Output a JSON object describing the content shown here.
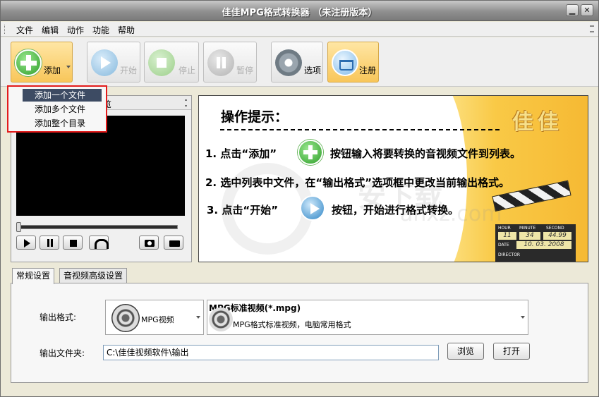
{
  "window": {
    "title": "佳佳MPG格式转换器  （未注册版本）",
    "min_glyph": "▁",
    "close_glyph": "✕"
  },
  "menu": {
    "items": [
      "文件",
      "编辑",
      "动作",
      "功能",
      "帮助"
    ]
  },
  "toolbar": {
    "add_label": "添加",
    "start_label": "开始",
    "stop_label": "停止",
    "pause_label": "暂停",
    "options_label": "选项",
    "register_label": "注册"
  },
  "add_menu": {
    "items": [
      "添加一个文件",
      "添加多个文件",
      "添加整个目录"
    ],
    "highlighted_index": 0
  },
  "preview": {
    "header_visible_text": "览"
  },
  "banner": {
    "heading": "操作提示：",
    "logo_text": "佳佳",
    "line1_a": "1. 点击“添加”",
    "line1_b": "按钮输入将要转换的音视频文件到列表。",
    "line2": "2. 选中列表中文件，在“输出格式”选项框中更改当前输出格式。",
    "line3_a": "3. 点击“开始”",
    "line3_b": "按钮，开始进行格式转换。",
    "watermark": "安下载",
    "watermark2": "anxz.com",
    "clapper": {
      "hour_label": "HOUR",
      "minute_label": "MINUTE",
      "second_label": "SECOND",
      "date_label": "DATE",
      "director_label": "DIRECTOR",
      "hour": "11",
      "minute": "34",
      "second": "44.99",
      "date": "10. 03. 2008"
    }
  },
  "tabs": {
    "general": "常规设置",
    "advanced": "音视频高级设置"
  },
  "settings": {
    "output_format_label": "输出格式:",
    "format_category": "MPG视频",
    "format_title": "MPG标准视频(*.mpg)",
    "format_desc": "MPG格式标准视频，电脑常用格式",
    "output_folder_label": "输出文件夹:",
    "output_folder_value": "C:\\佳佳视频软件\\输出",
    "browse_label": "浏览",
    "open_label": "打开"
  },
  "colors": {
    "highlight_border": "#e31b1b",
    "menu_selection": "#3d4b63",
    "accent_button": "#f8c65a"
  }
}
